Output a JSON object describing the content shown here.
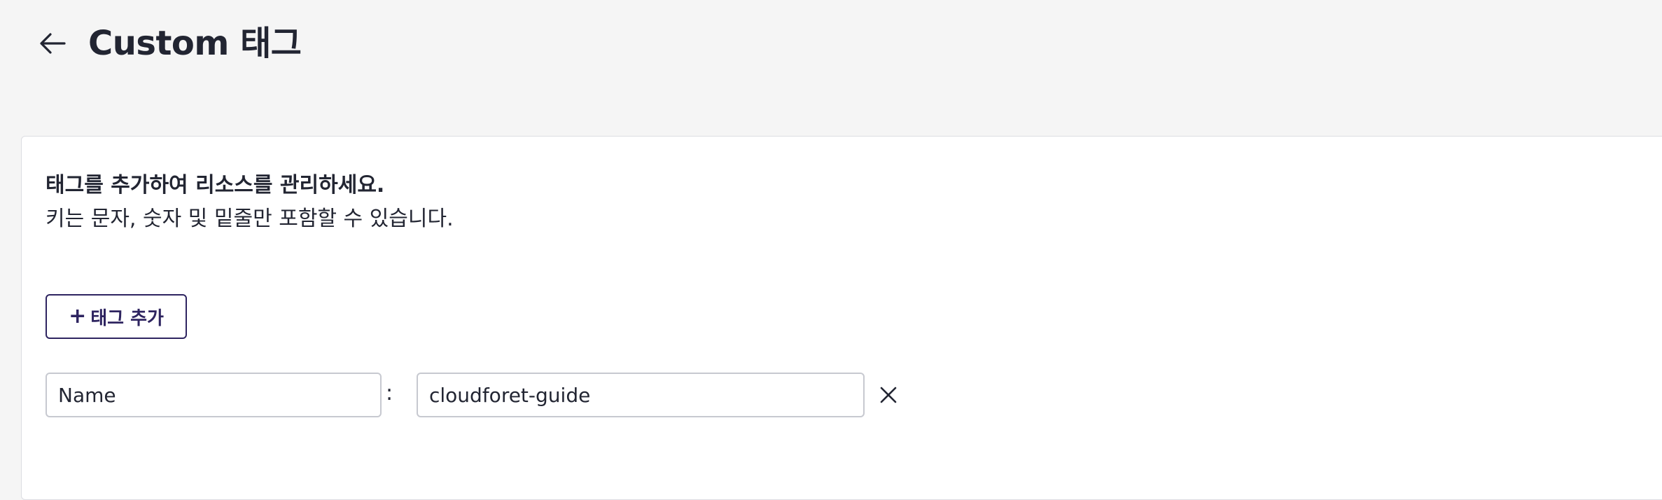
{
  "header": {
    "back_icon": "arrow-left-icon",
    "title": "Custom 태그"
  },
  "panel": {
    "description_title": "태그를 추가하여 리소스를 관리하세요.",
    "description_detail": "키는 문자, 숫자 및 밑줄만 포함할 수 있습니다.",
    "add_button": {
      "icon": "plus-icon",
      "icon_glyph": "+",
      "label": "태그 추가"
    },
    "tags": [
      {
        "key": "Name",
        "separator": ":",
        "value": "cloudforet-guide",
        "delete_icon": "close-icon"
      }
    ]
  },
  "colors": {
    "page_background": "#f5f5f5",
    "panel_background": "#ffffff",
    "accent": "#2e2460",
    "text": "#222532",
    "border": "#c7c9d0"
  }
}
